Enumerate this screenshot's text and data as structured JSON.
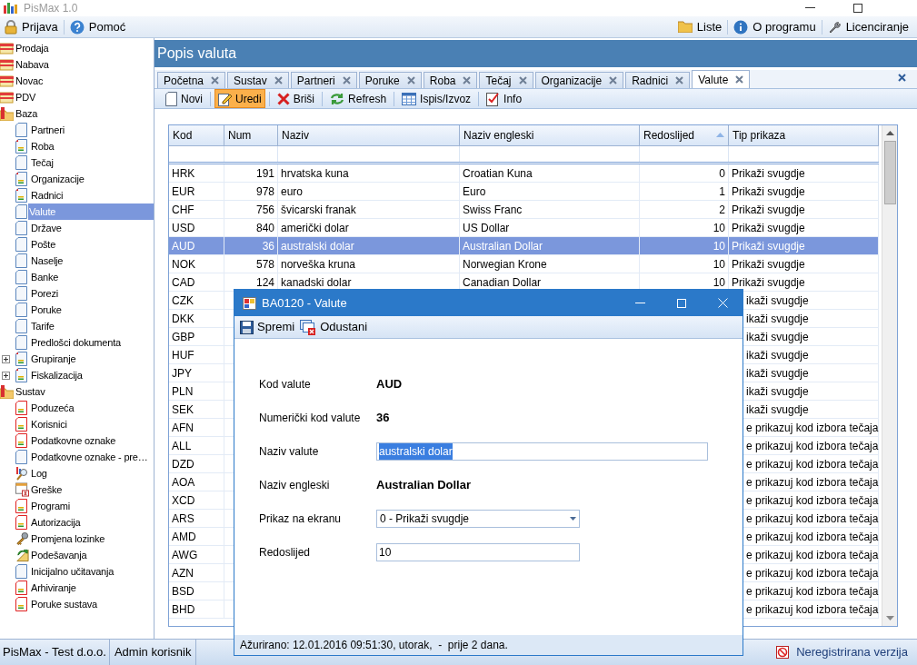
{
  "window": {
    "title": "PisMax 1.0"
  },
  "menu_left": [
    {
      "label": "Prijava",
      "kind": "lock"
    },
    {
      "label": "Pomoć",
      "kind": "help"
    }
  ],
  "menu_right": [
    {
      "label": "Liste",
      "kind": "folder"
    },
    {
      "label": "O programu",
      "kind": "info"
    },
    {
      "label": "Licenciranje",
      "kind": "tools"
    }
  ],
  "sidebar": {
    "items": [
      {
        "label": "Prodaja",
        "kind": "module",
        "selected": false
      },
      {
        "label": "Nabava",
        "kind": "module",
        "selected": false
      },
      {
        "label": "Novac",
        "kind": "module",
        "selected": false
      },
      {
        "label": "PDV",
        "kind": "module",
        "selected": false
      },
      {
        "label": "Baza",
        "kind": "group",
        "selected": false,
        "children": [
          {
            "label": "Partneri",
            "kind": "page",
            "selected": false
          },
          {
            "label": "Roba",
            "kind": "report",
            "selected": false
          },
          {
            "label": "Tečaj",
            "kind": "page",
            "selected": false
          },
          {
            "label": "Organizacije",
            "kind": "report",
            "selected": false
          },
          {
            "label": "Radnici",
            "kind": "report",
            "selected": false
          },
          {
            "label": "Valute",
            "kind": "page",
            "selected": true
          },
          {
            "label": "Države",
            "kind": "page",
            "selected": false
          },
          {
            "label": "Pošte",
            "kind": "page",
            "selected": false
          },
          {
            "label": "Naselje",
            "kind": "page",
            "selected": false
          },
          {
            "label": "Banke",
            "kind": "page",
            "selected": false
          },
          {
            "label": "Porezi",
            "kind": "page",
            "selected": false
          },
          {
            "label": "Poruke",
            "kind": "page",
            "selected": false
          },
          {
            "label": "Tarife",
            "kind": "page",
            "selected": false
          },
          {
            "label": "Predlošci dokumenta",
            "kind": "page",
            "selected": false
          },
          {
            "label": "Grupiranje",
            "kind": "report",
            "selected": false,
            "expanded": false
          },
          {
            "label": "Fiskalizacija",
            "kind": "report",
            "selected": false,
            "expanded": false
          }
        ]
      },
      {
        "label": "Sustav",
        "kind": "group",
        "selected": false,
        "children": [
          {
            "label": "Poduzeća",
            "kind": "form",
            "selected": false
          },
          {
            "label": "Korisnici",
            "kind": "form",
            "selected": false
          },
          {
            "label": "Podatkovne oznake",
            "kind": "form",
            "selected": false
          },
          {
            "label": "Podatkovne oznake - pre…",
            "kind": "page",
            "selected": false
          },
          {
            "label": "Log",
            "kind": "log",
            "selected": false
          },
          {
            "label": "Greške",
            "kind": "errors",
            "selected": false
          },
          {
            "label": "Programi",
            "kind": "form",
            "selected": false
          },
          {
            "label": "Autorizacija",
            "kind": "form",
            "selected": false
          },
          {
            "label": "Promjena lozinke",
            "kind": "key",
            "selected": false
          },
          {
            "label": "Podešavanja",
            "kind": "settings",
            "selected": false
          },
          {
            "label": "Inicijalno učitavanja",
            "kind": "page",
            "selected": false
          },
          {
            "label": "Arhiviranje",
            "kind": "form",
            "selected": false
          },
          {
            "label": "Poruke sustava",
            "kind": "form",
            "selected": false
          }
        ]
      }
    ]
  },
  "page": {
    "title": "Popis valuta"
  },
  "tabs": [
    {
      "label": "Početna",
      "selected": false
    },
    {
      "label": "Sustav",
      "selected": false
    },
    {
      "label": "Partneri",
      "selected": false
    },
    {
      "label": "Poruke",
      "selected": false
    },
    {
      "label": "Roba",
      "selected": false
    },
    {
      "label": "Tečaj",
      "selected": false
    },
    {
      "label": "Organizacije",
      "selected": false
    },
    {
      "label": "Radnici",
      "selected": false
    },
    {
      "label": "Valute",
      "selected": true
    }
  ],
  "toolbar": [
    {
      "label": "Novi",
      "kind": "new",
      "selected": false
    },
    {
      "label": "Uredi",
      "kind": "edit",
      "selected": true
    },
    {
      "label": "Briši",
      "kind": "delete",
      "selected": false
    },
    {
      "label": "Refresh",
      "kind": "refresh",
      "selected": false
    },
    {
      "label": "Ispis/Izvoz",
      "kind": "export",
      "selected": false
    },
    {
      "label": "Info",
      "kind": "info",
      "selected": false
    }
  ],
  "table": {
    "columns": [
      {
        "label": "Kod"
      },
      {
        "label": "Num"
      },
      {
        "label": "Naziv"
      },
      {
        "label": "Naziv engleski"
      },
      {
        "label": "Redoslijed",
        "sorted": true
      },
      {
        "label": "Tip prikaza"
      }
    ],
    "rows": [
      {
        "kod": "HRK",
        "num": "191",
        "naziv": "hrvatska kuna",
        "naziv_engleski": "Croatian Kuna",
        "redoslijed": "0",
        "tip_prikaza": "Prikaži svugdje",
        "selected": false
      },
      {
        "kod": "EUR",
        "num": "978",
        "naziv": "euro",
        "naziv_engleski": "Euro",
        "redoslijed": "1",
        "tip_prikaza": "Prikaži svugdje",
        "selected": false
      },
      {
        "kod": "CHF",
        "num": "756",
        "naziv": "švicarski franak",
        "naziv_engleski": "Swiss Franc",
        "redoslijed": "2",
        "tip_prikaza": "Prikaži svugdje",
        "selected": false
      },
      {
        "kod": "USD",
        "num": "840",
        "naziv": "američki dolar",
        "naziv_engleski": "US Dollar",
        "redoslijed": "10",
        "tip_prikaza": "Prikaži svugdje",
        "selected": false
      },
      {
        "kod": "AUD",
        "num": "36",
        "naziv": "australski dolar",
        "naziv_engleski": "Australian Dollar",
        "redoslijed": "10",
        "tip_prikaza": "Prikaži svugdje",
        "selected": true
      },
      {
        "kod": "NOK",
        "num": "578",
        "naziv": "norveška kruna",
        "naziv_engleski": "Norwegian Krone",
        "redoslijed": "10",
        "tip_prikaza": "Prikaži svugdje",
        "selected": false
      },
      {
        "kod": "CAD",
        "num": "124",
        "naziv": "kanadski dolar",
        "naziv_engleski": "Canadian Dollar",
        "redoslijed": "10",
        "tip_prikaza": "Prikaži svugdje",
        "selected": false
      },
      {
        "kod": "CZK",
        "tip_prikaza": "ikaži svugdje",
        "selected": false
      },
      {
        "kod": "DKK",
        "tip_prikaza": "ikaži svugdje",
        "selected": false
      },
      {
        "kod": "GBP",
        "tip_prikaza": "ikaži svugdje",
        "selected": false
      },
      {
        "kod": "HUF",
        "tip_prikaza": "ikaži svugdje",
        "selected": false
      },
      {
        "kod": "JPY",
        "tip_prikaza": "ikaži svugdje",
        "selected": false
      },
      {
        "kod": "PLN",
        "tip_prikaza": "ikaži svugdje",
        "selected": false
      },
      {
        "kod": "SEK",
        "tip_prikaza": "ikaži svugdje",
        "selected": false
      },
      {
        "kod": "AFN",
        "tip_prikaza": "e prikazuj kod izbora tečaja",
        "selected": false
      },
      {
        "kod": "ALL",
        "tip_prikaza": "e prikazuj kod izbora tečaja",
        "selected": false
      },
      {
        "kod": "DZD",
        "tip_prikaza": "e prikazuj kod izbora tečaja",
        "selected": false
      },
      {
        "kod": "AOA",
        "tip_prikaza": "e prikazuj kod izbora tečaja",
        "selected": false
      },
      {
        "kod": "XCD",
        "tip_prikaza": "e prikazuj kod izbora tečaja",
        "selected": false
      },
      {
        "kod": "ARS",
        "tip_prikaza": "e prikazuj kod izbora tečaja",
        "selected": false
      },
      {
        "kod": "AMD",
        "tip_prikaza": "e prikazuj kod izbora tečaja",
        "selected": false
      },
      {
        "kod": "AWG",
        "tip_prikaza": "e prikazuj kod izbora tečaja",
        "selected": false
      },
      {
        "kod": "AZN",
        "tip_prikaza": "e prikazuj kod izbora tečaja",
        "selected": false
      },
      {
        "kod": "BSD",
        "tip_prikaza": "e prikazuj kod izbora tečaja",
        "selected": false
      },
      {
        "kod": "BHD",
        "tip_prikaza": "e prikazuj kod izbora tečaja",
        "selected": false
      }
    ]
  },
  "dialog": {
    "title": "BA0120 - Valute",
    "toolbar": [
      {
        "label": "Spremi",
        "kind": "save"
      },
      {
        "label": "Odustani",
        "kind": "cancel"
      }
    ],
    "fields": [
      {
        "label": "Kod valute",
        "kind": "value",
        "value": "AUD"
      },
      {
        "label": "Numerički kod valute",
        "kind": "value",
        "value": "36"
      },
      {
        "label": "Naziv valute",
        "kind": "input",
        "value": "australski dolar",
        "highlighted": true
      },
      {
        "label": "Naziv engleski",
        "kind": "value",
        "value": "Australian Dollar"
      },
      {
        "label": "Prikaz na ekranu",
        "kind": "select",
        "value": "0 - Prikaži svugdje"
      },
      {
        "label": "Redoslijed",
        "kind": "short_input",
        "value": "10",
        "highlighted": false
      }
    ],
    "footer": "Ažurirano: 12.01.2016 09:51:30, utorak,  -  prije 2 dana."
  },
  "status_bar": {
    "company": "PisMax - Test d.o.o.",
    "user": "Admin korisnik",
    "notice": "Neregistrirana verzija"
  }
}
